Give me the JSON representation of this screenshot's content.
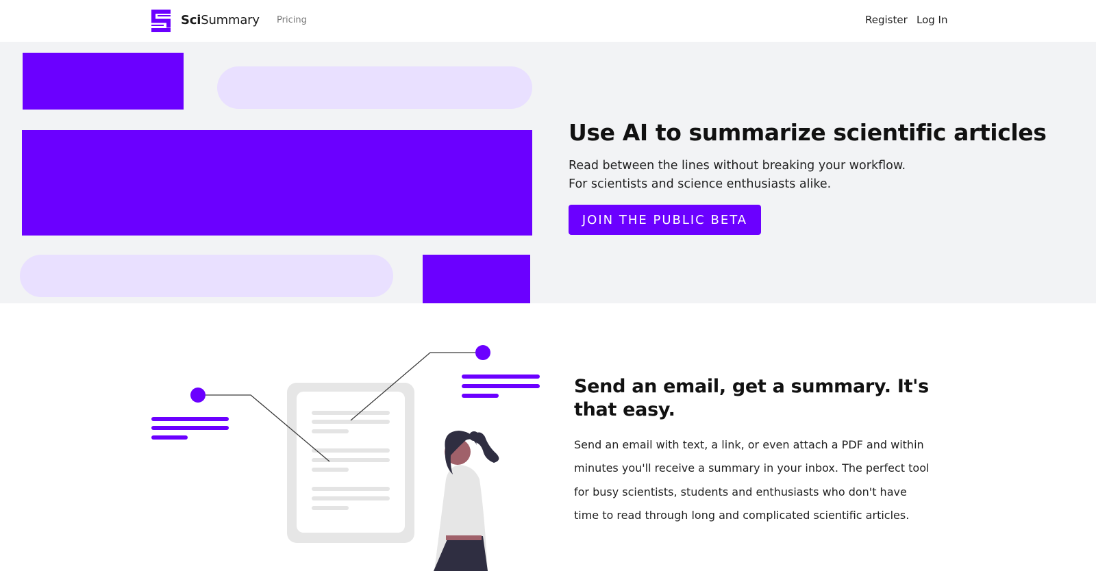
{
  "nav": {
    "brand_bold": "Sci",
    "brand_regular": "Summary",
    "pricing": "Pricing",
    "register": "Register",
    "login": "Log In"
  },
  "hero": {
    "title": "Use AI to summarize scientific articles",
    "subtitle_line1": "Read between the lines without breaking your workflow.",
    "subtitle_line2": "For scientists and science enthusiasts alike.",
    "cta": "JOIN THE PUBLIC BETA"
  },
  "feature": {
    "title": "Send an email, get a summary. It's that easy.",
    "body": "Send an email with text, a link, or even attach a PDF and within minutes you'll receive a summary in your inbox. The perfect tool for busy scientists, students and enthusiasts who don't have time to read through long and complicated scientific articles."
  },
  "colors": {
    "accent": "#6b00ff",
    "accent_light": "#e9e0ff",
    "hero_bg": "#f2f3f5",
    "doc_gray": "#e8e8e8"
  },
  "icons": [
    "scisummary-logo-icon"
  ]
}
